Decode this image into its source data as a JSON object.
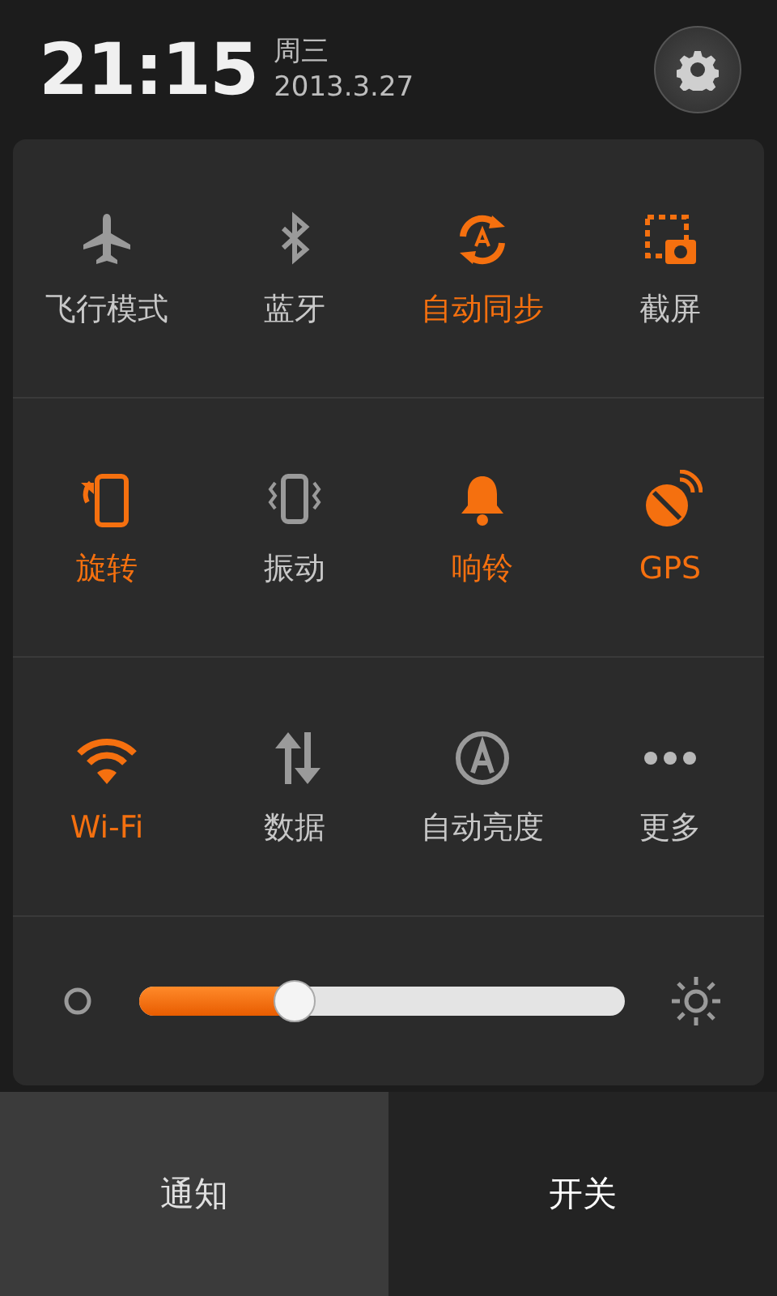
{
  "status": {
    "time": "21:15",
    "weekday": "周三",
    "date": "2013.3.27"
  },
  "toggles": [
    {
      "label": "飞行模式",
      "kind": "toggle",
      "on": false
    },
    {
      "label": "蓝牙",
      "kind": "toggle",
      "on": false
    },
    {
      "label": "自动同步",
      "kind": "toggle",
      "on": true
    },
    {
      "label": "截屏",
      "kind": "action"
    },
    {
      "label": "旋转",
      "kind": "toggle",
      "on": true
    },
    {
      "label": "振动",
      "kind": "toggle",
      "on": false
    },
    {
      "label": "响铃",
      "kind": "toggle",
      "on": true
    },
    {
      "label": "GPS",
      "kind": "toggle",
      "on": true
    },
    {
      "label": "Wi-Fi",
      "kind": "toggle",
      "on": true
    },
    {
      "label": "数据",
      "kind": "toggle",
      "on": false
    },
    {
      "label": "自动亮度",
      "kind": "toggle",
      "on": false
    },
    {
      "label": "更多",
      "kind": "menu"
    }
  ],
  "brightness": {
    "level": 0.32
  },
  "tabs": [
    {
      "label": "通知",
      "selected": false
    },
    {
      "label": "开关",
      "selected": true
    }
  ]
}
